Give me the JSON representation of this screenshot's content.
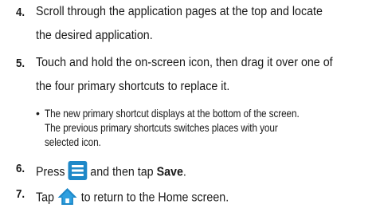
{
  "steps": [
    {
      "number": "4.",
      "lines": [
        "Scroll through the application pages at the top and locate",
        "the desired application."
      ]
    },
    {
      "number": "5.",
      "lines": [
        "Touch and hold the on-screen icon, then drag it over one of",
        "the four primary shortcuts to replace it."
      ],
      "bullet": [
        "The new primary shortcut displays at the bottom of the screen.",
        "The previous primary shortcuts switches places with your",
        "selected icon."
      ]
    },
    {
      "number": "6.",
      "before_icon": "Press",
      "icon": "menu-key-icon",
      "after_icon": "and then tap",
      "bold": "Save",
      "end": "."
    },
    {
      "number": "7.",
      "before_icon": "Tap",
      "icon": "home-key-icon",
      "after_icon": "to return to the Home screen."
    }
  ],
  "colors": {
    "menu_icon": "#1e88c8",
    "home_icon": "#1e88c8"
  }
}
